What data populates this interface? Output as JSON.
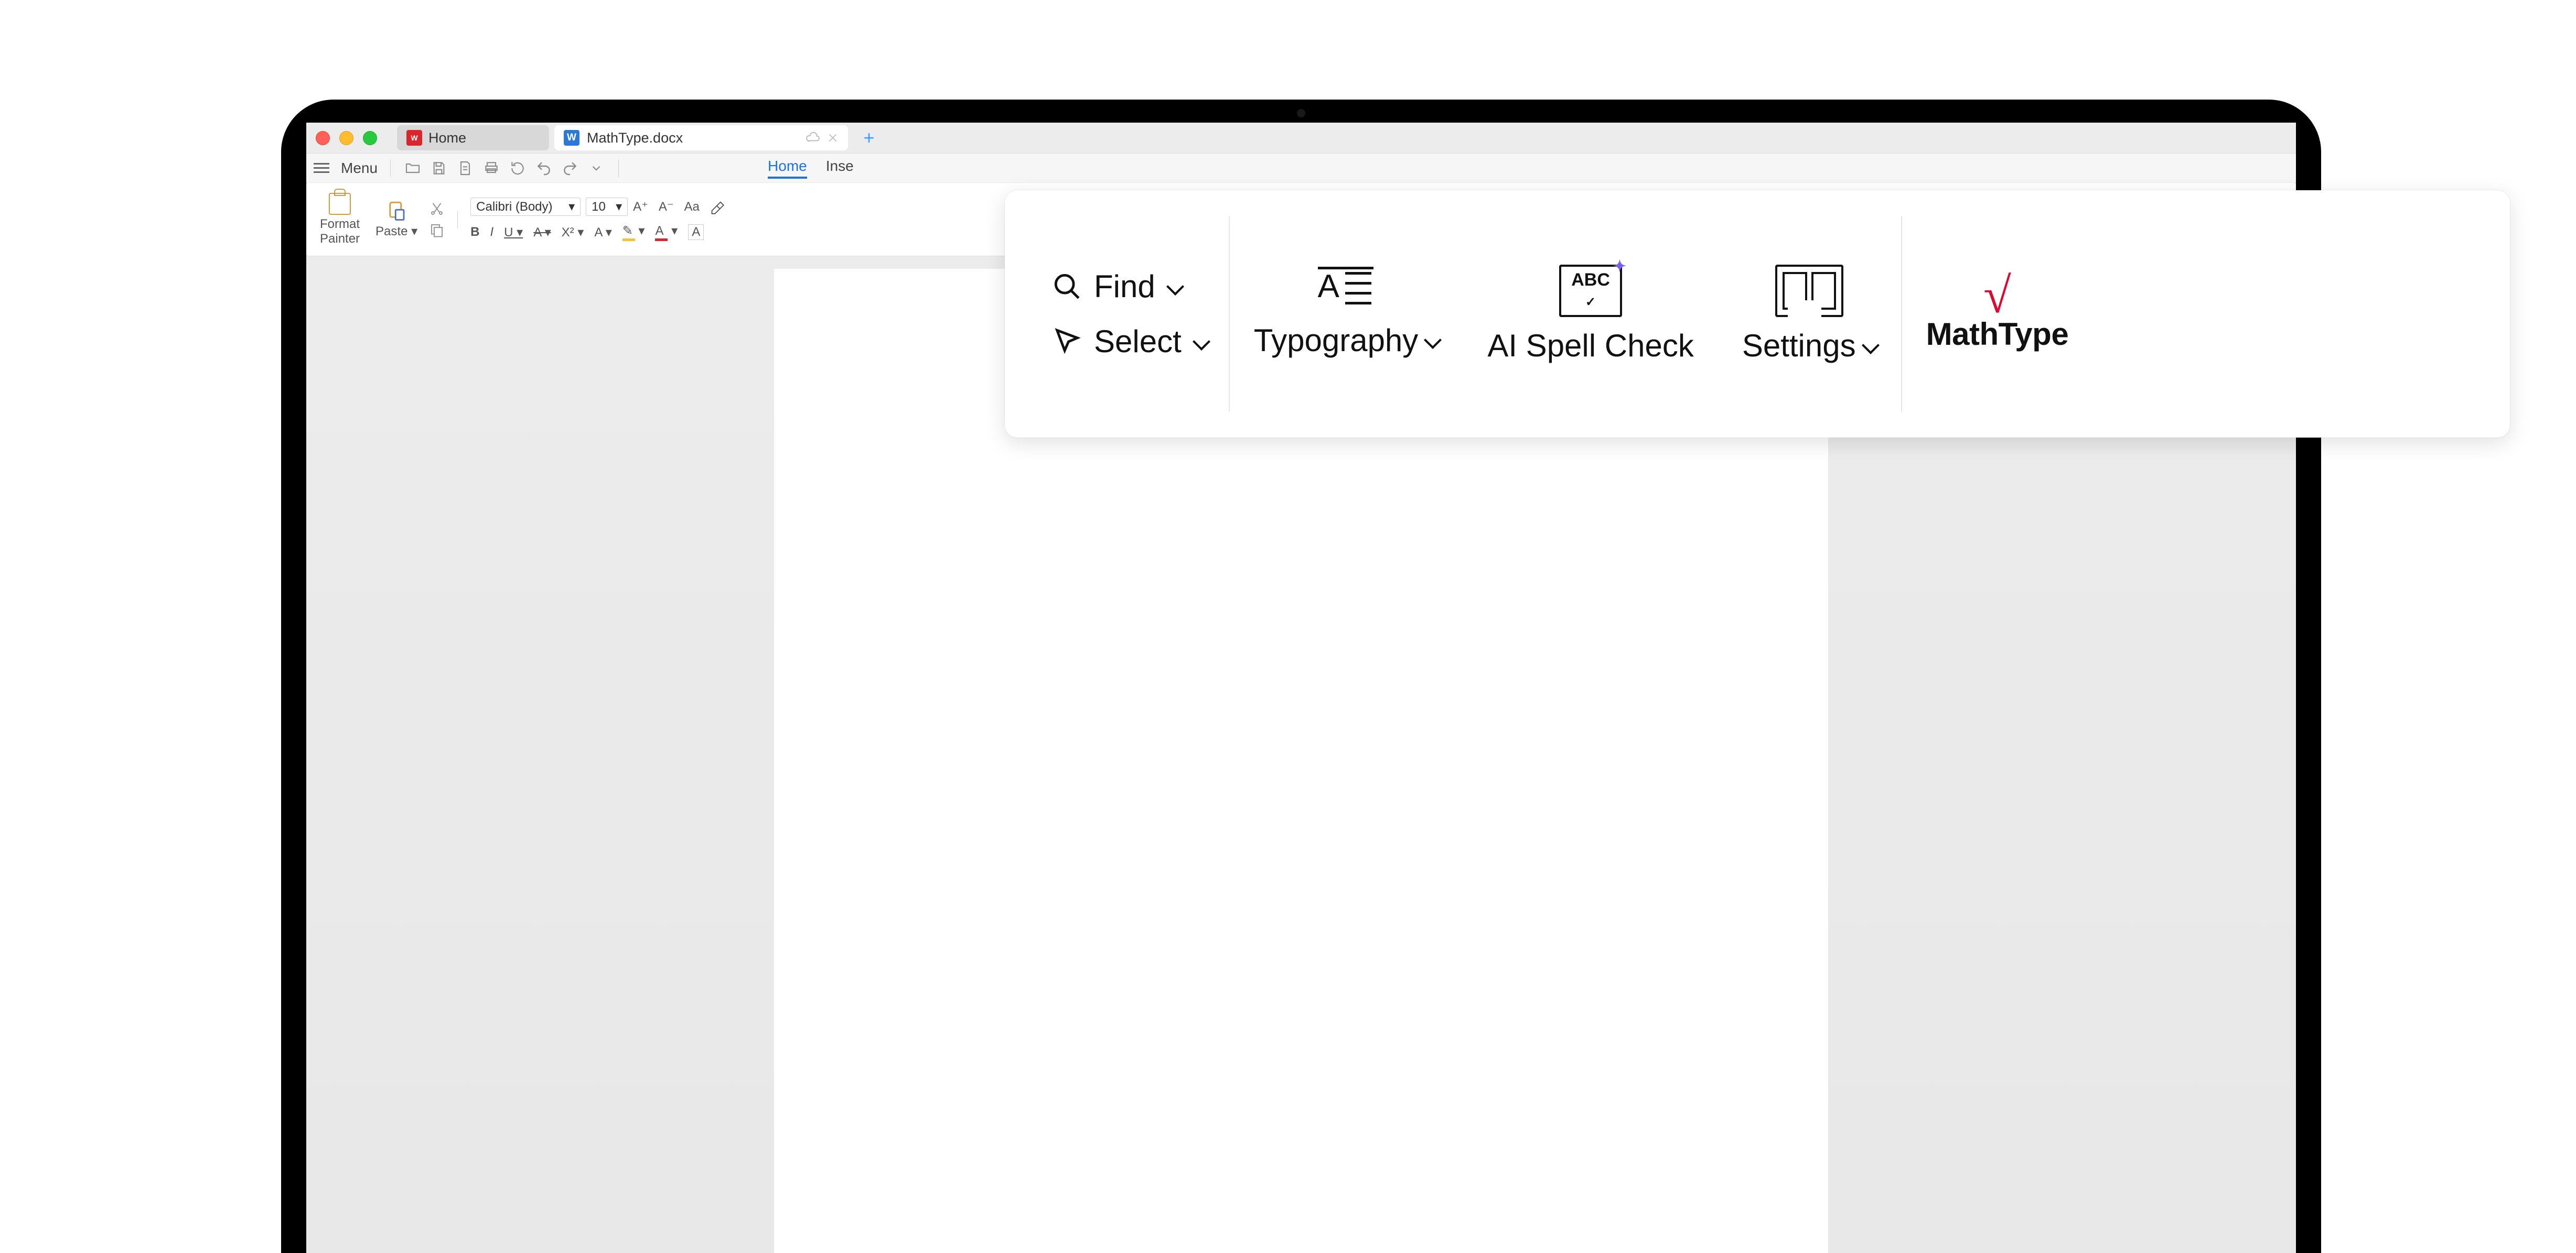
{
  "titlebar": {
    "home_tab": "Home",
    "doc_tab": "MathType.docx",
    "doc_short_icon": "W"
  },
  "menubar": {
    "menu": "Menu",
    "ribbon_tabs": {
      "home": "Home",
      "insert": "Inse"
    }
  },
  "ribbon": {
    "format_painter": "Format\nPainter",
    "paste": "Paste",
    "font_name": "Calibri (Body)",
    "font_size": "10",
    "aplus": "A⁺",
    "aminus": "A⁻",
    "aa": "Aa",
    "bold": "B",
    "italic": "I",
    "underline": "U",
    "strike": "A",
    "xsup": "X²",
    "acolor": "A",
    "abox": "A"
  },
  "panel": {
    "find": "Find",
    "select": "Select",
    "typography": "Typography",
    "spellcheck": "AI Spell Check",
    "spellcheck_icon_text": "ABC",
    "settings": "Settings",
    "mathtype": "MathType",
    "mathtype_symbol": "√"
  }
}
